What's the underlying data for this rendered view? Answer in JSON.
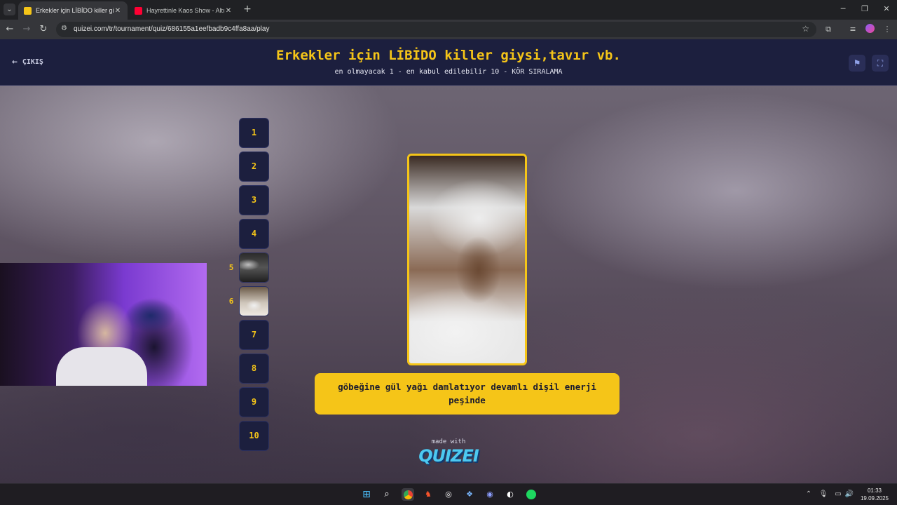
{
  "browser": {
    "tabs": [
      {
        "title": "Erkekler için LİBİDO killer giysi,t",
        "active": true
      },
      {
        "title": "Hayrettinle Kaos Show - Altın ç",
        "active": false
      }
    ],
    "url": "quizei.com/tr/tournament/quiz/686155a1eefbadb9c4ffa8aa/play",
    "new_tab_glyph": "+"
  },
  "header": {
    "exit_label": "ÇIKIŞ",
    "title": "Erkekler için LİBİDO killer giysi,tavır vb.",
    "subtitle": "en olmayacak 1 - en kabul edilebilir 10 - KÖR SIRALAMA"
  },
  "ranking": {
    "slots": [
      "1",
      "2",
      "3",
      "4",
      "5",
      "6",
      "7",
      "8",
      "9",
      "10"
    ],
    "filled_labels": [
      "5",
      "6"
    ]
  },
  "answer": {
    "text": "göbeğine gül yağı damlatıyor devamlı dişil enerji peşinde"
  },
  "footer": {
    "made_with": "made with",
    "logo_text": "QUIZEI"
  },
  "taskbar": {
    "time": "01:33",
    "date": "19.09.2025"
  },
  "colors": {
    "accent": "#f5c518",
    "header_bg": "#1c1f3e",
    "logo": "#4cc9f0"
  },
  "icons": [
    "back-icon",
    "forward-icon",
    "reload-icon",
    "star-icon",
    "extensions-icon",
    "menu-icon",
    "flag-icon",
    "fullscreen-icon",
    "windows-start-icon",
    "search-icon",
    "chrome-icon",
    "brave-icon",
    "discord-icon",
    "spotify-icon"
  ]
}
